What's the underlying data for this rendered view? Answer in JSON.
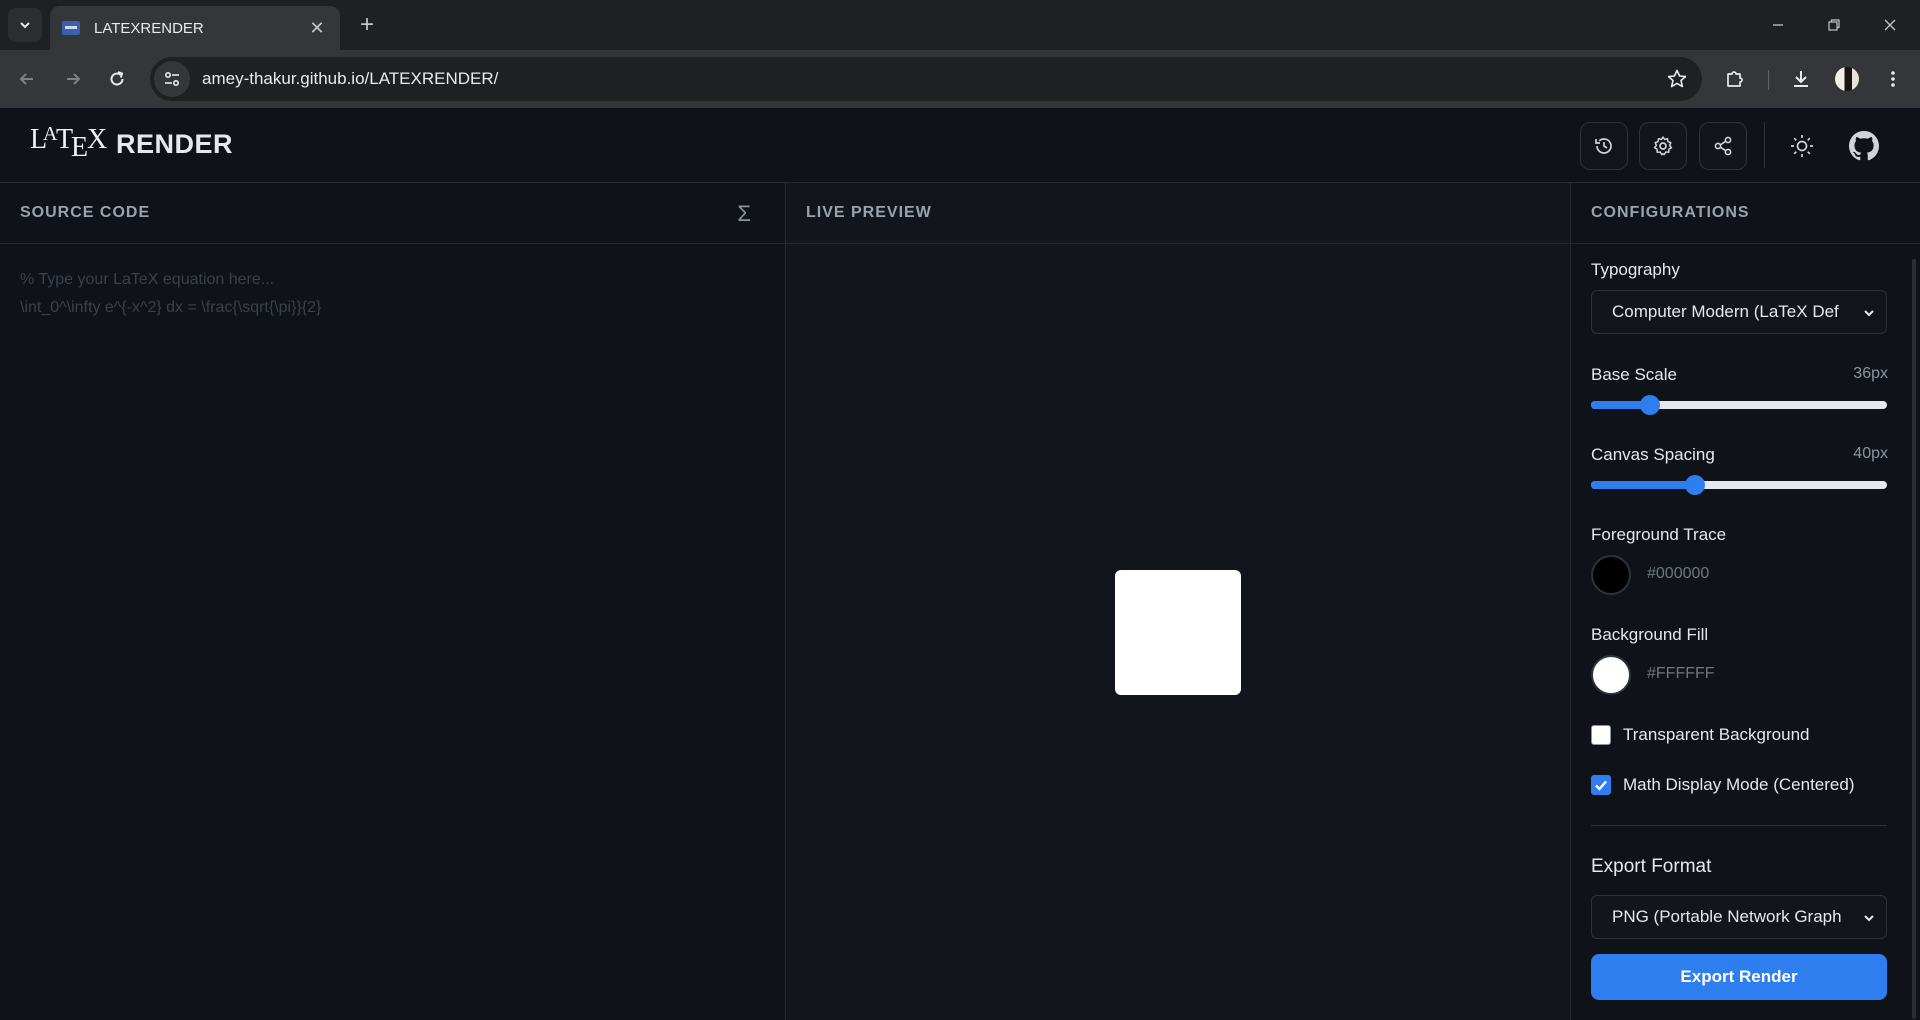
{
  "browser": {
    "tab_title": "LATEXRENDER",
    "url": "amey-thakur.github.io/LATEXRENDER/"
  },
  "app": {
    "logo_tex": "LATEX",
    "logo_render": "RENDER",
    "header_icons": [
      "history-icon",
      "settings-icon",
      "share-icon",
      "sun-icon",
      "github-icon"
    ]
  },
  "source": {
    "title": "SOURCE CODE",
    "sigma": "Σ",
    "placeholder_line1": "% Type your LaTeX equation here...",
    "placeholder_line2": "\\int_0^\\infty e^{-x^2} dx = \\frac{\\sqrt{\\pi}}{2}"
  },
  "preview": {
    "title": "LIVE PREVIEW"
  },
  "config": {
    "title": "CONFIGURATIONS",
    "typography_label": "Typography",
    "typography_value": "Computer Modern (LaTeX Def",
    "base_scale_label": "Base Scale",
    "base_scale_value": "36px",
    "base_scale_fraction": 0.2,
    "canvas_spacing_label": "Canvas Spacing",
    "canvas_spacing_value": "40px",
    "canvas_spacing_fraction": 0.35,
    "foreground_label": "Foreground Trace",
    "foreground_hex": "#000000",
    "foreground_color": "#000000",
    "background_label": "Background Fill",
    "background_hex": "#FFFFFF",
    "background_color": "#FFFFFF",
    "transparent_label": "Transparent Background",
    "transparent_checked": false,
    "display_mode_label": "Math Display Mode (Centered)",
    "display_mode_checked": true,
    "export_format_label": "Export Format",
    "export_format_value": "PNG (Portable Network Graph",
    "export_button": "Export Render"
  },
  "colors": {
    "accent": "#2f7ef0",
    "background": "#0f1218",
    "preview_bg": "#12161c"
  }
}
